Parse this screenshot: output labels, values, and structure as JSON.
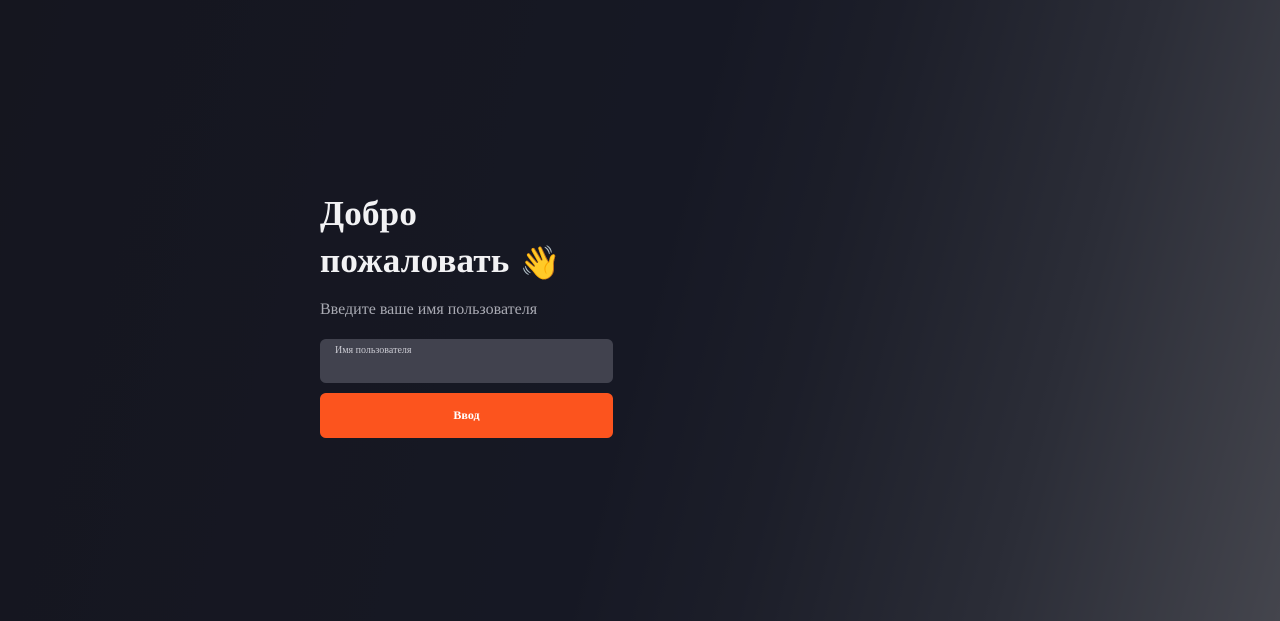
{
  "login": {
    "title_line1": "Добро",
    "title_line2": "пожаловать",
    "title_emoji": "👋",
    "subtitle": "Введите ваше имя пользователя",
    "username_label": "Имя пользователя",
    "username_value": "",
    "submit_label": "Ввод"
  },
  "colors": {
    "accent": "#fc541e",
    "input_background": "#41424e",
    "background_dark": "#15161f",
    "background_light": "#44454d"
  },
  "icons": {
    "title_emoji": "waving-hand-icon"
  }
}
